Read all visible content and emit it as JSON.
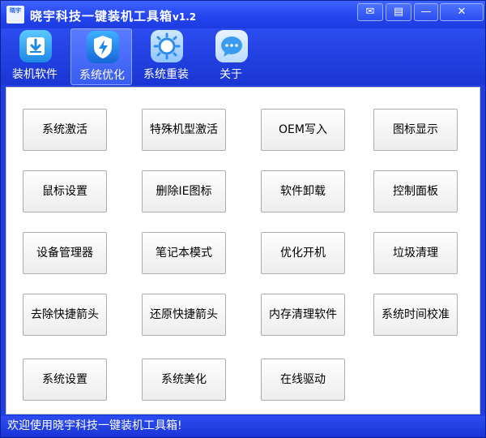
{
  "window": {
    "title": "晓宇科技一键装机工具箱",
    "version": "v1.2",
    "app_icon_text": "晓宇"
  },
  "title_buttons": {
    "skin": "✉",
    "menu": "▤",
    "minimize": "—",
    "close": "✕"
  },
  "toolbar": {
    "items": [
      {
        "label": "装机软件",
        "icon": "download-icon",
        "active": false
      },
      {
        "label": "系统优化",
        "icon": "shield-lightning-icon",
        "active": true
      },
      {
        "label": "系统重装",
        "icon": "gear-sun-icon",
        "active": false
      },
      {
        "label": "关于",
        "icon": "chat-bubble-icon",
        "active": false
      }
    ]
  },
  "buttons": [
    [
      "系统激活",
      "特殊机型激活",
      "OEM写入",
      "图标显示"
    ],
    [
      "鼠标设置",
      "删除IE图标",
      "软件卸载",
      "控制面板"
    ],
    [
      "设备管理器",
      "笔记本模式",
      "优化开机",
      "垃圾清理"
    ],
    [
      "去除快捷箭头",
      "还原快捷箭头",
      "内存清理软件",
      "系统时间校准"
    ],
    [
      "系统设置",
      "系统美化",
      "在线驱动"
    ]
  ],
  "status": {
    "text": "欢迎使用晓宇科技一键装机工具箱!"
  },
  "colors": {
    "titlebar": "#2244ee",
    "accent": "#1f3fe0",
    "button_face": "#f4f4f4"
  }
}
